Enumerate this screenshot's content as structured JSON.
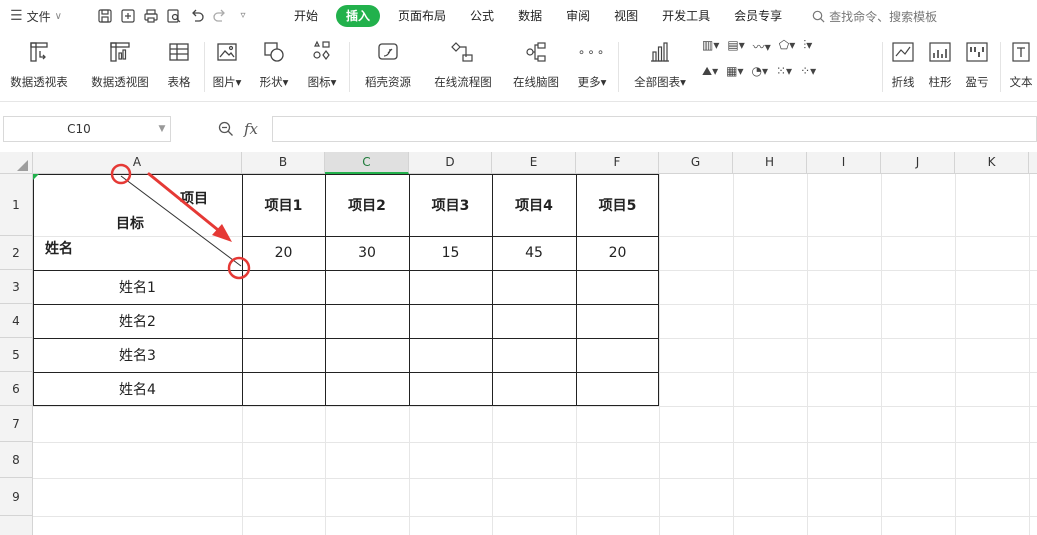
{
  "menu": {
    "hamburger": "☰",
    "file_label": "文件",
    "search_text": "查找命令、搜索模板"
  },
  "tabs": [
    {
      "label": "开始"
    },
    {
      "label": "插入"
    },
    {
      "label": "页面布局"
    },
    {
      "label": "公式"
    },
    {
      "label": "数据"
    },
    {
      "label": "审阅"
    },
    {
      "label": "视图"
    },
    {
      "label": "开发工具"
    },
    {
      "label": "会员专享"
    }
  ],
  "ribbon": {
    "pivot_table": "数据透视表",
    "pivot_chart": "数据透视图",
    "table": "表格",
    "picture": "图片",
    "shape": "形状",
    "icon": "图标",
    "resources": "稻壳资源",
    "flowchart": "在线流程图",
    "mindmap": "在线脑图",
    "more": "更多",
    "all_charts": "全部图表",
    "line": "折线",
    "column": "柱形",
    "winloss": "盈亏",
    "textbox": "文本"
  },
  "formula_bar": {
    "cell_ref": "C10",
    "fx": "fx",
    "value": ""
  },
  "columns": [
    "A",
    "B",
    "C",
    "D",
    "E",
    "F",
    "G",
    "H",
    "I",
    "J",
    "K"
  ],
  "rows": [
    "1",
    "2",
    "3",
    "4",
    "5",
    "6",
    "7",
    "8",
    "9"
  ],
  "sheet": {
    "header_item": "项目",
    "header_target": "目标",
    "header_name": "姓名",
    "items": [
      "项目1",
      "项目2",
      "项目3",
      "项目4",
      "项目5"
    ],
    "targets": [
      "20",
      "30",
      "15",
      "45",
      "20"
    ],
    "names": [
      "姓名1",
      "姓名2",
      "姓名3",
      "姓名4"
    ]
  },
  "colors": {
    "accent": "#22b14c",
    "annotation": "#e53935"
  }
}
